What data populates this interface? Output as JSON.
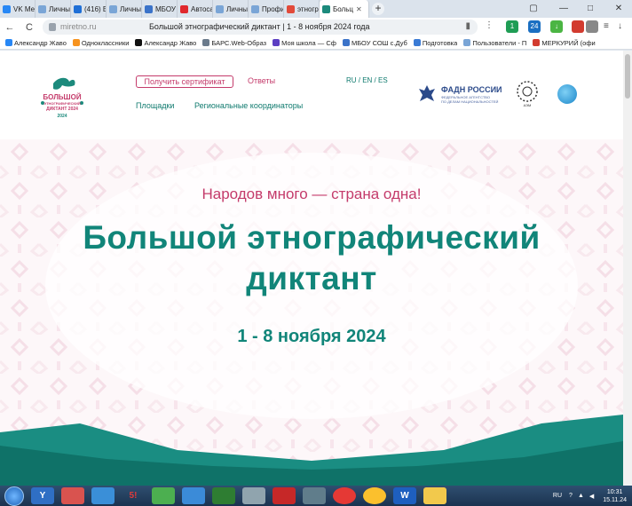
{
  "browser": {
    "tabs": [
      {
        "label": "VK Мес",
        "color": "#2787f5",
        "glyph": "vk"
      },
      {
        "label": "Личный",
        "color": "#7aa5d6",
        "glyph": ""
      },
      {
        "label": "(416) Вх",
        "color": "#1f6fd6",
        "glyph": ""
      },
      {
        "label": "Личный",
        "color": "#7aa5d6",
        "glyph": ""
      },
      {
        "label": "МБОУ С",
        "color": "#3b73c9",
        "glyph": ""
      },
      {
        "label": "Автосал",
        "color": "#e0282d",
        "glyph": ""
      },
      {
        "label": "Личный",
        "color": "#7aa5d6",
        "glyph": ""
      },
      {
        "label": "Профил",
        "color": "#7aa5d6",
        "glyph": ""
      },
      {
        "label": "этногра",
        "color": "#e24a3a",
        "glyph": ""
      },
      {
        "label": "Больц",
        "color": "#1c8a7c",
        "glyph": "",
        "active": true
      }
    ],
    "new_tab_label": "+",
    "window_controls": {
      "tabs_icon": "▢",
      "minimize": "—",
      "maximize": "□",
      "close": "✕"
    },
    "nav": {
      "back": "←",
      "forward": "→",
      "reload": "C"
    },
    "address": {
      "domain": "miretno.ru",
      "page_title": "Большой этнографический диктант | 1 - 8 ноября 2024 года"
    },
    "extensions": [
      {
        "name": "shield-extension-icon",
        "color": "#1f9d55",
        "label": "1"
      },
      {
        "name": "counter-extension-icon",
        "color": "#1a6fc2",
        "label": "24"
      },
      {
        "name": "download-extension-icon",
        "color": "#4bb543",
        "label": "↓"
      },
      {
        "name": "profile-extension-icon",
        "color": "#d23b2f",
        "label": ""
      },
      {
        "name": "puzzle-extension-icon",
        "color": "#888888",
        "label": ""
      }
    ],
    "bookmarks": [
      {
        "label": "Александр Жаво",
        "color": "#2787f5"
      },
      {
        "label": "Одноклассники",
        "color": "#f7931e"
      },
      {
        "label": "Александр Жаво",
        "color": "#111111"
      },
      {
        "label": "БАРС.Web-Образ",
        "color": "#6b7b8c"
      },
      {
        "label": "Моя школа — Сф",
        "color": "#5c3ec2"
      },
      {
        "label": "МБОУ СОШ с.Дуб",
        "color": "#3b73c9"
      },
      {
        "label": "Подготовка",
        "color": "#3a7bd5"
      },
      {
        "label": "Пользователи - П",
        "color": "#7aa5d6"
      },
      {
        "label": "МЕРКУРИЙ (офи",
        "color": "#d23b2f"
      }
    ]
  },
  "site": {
    "logo": {
      "line1": "БОЛЬШОЙ",
      "line2": "ЭТНОГРАФИЧЕСКИЙ",
      "line3": "ДИКТАНТ 2024",
      "line4": "2024"
    },
    "certificate_button": "Получить сертификат",
    "nav_answers": "Ответы",
    "nav_venues": "Площадки",
    "nav_coordinators": "Региональные координаторы",
    "languages": "RU / EN / ES",
    "fadn": {
      "title": "ФАДН РОССИИ",
      "subtitle_1": "ФЕДЕРАЛЬНОЕ АГЕНТСТВО",
      "subtitle_2": "ПО ДЕЛАМ НАЦИОНАЛЬНОСТЕЙ"
    },
    "partner_logo_caption": "АЭМ"
  },
  "hero": {
    "slogan": "Народов много — страна одна!",
    "title_line1": "Большой этнографический",
    "title_line2": "диктант",
    "dates": "1 - 8 ноября 2024"
  },
  "taskbar": {
    "language": "RU",
    "time": "10:31",
    "date": "15.11.24",
    "colors": {
      "accent_pink": "#c43b6b",
      "accent_teal": "#118579"
    }
  }
}
